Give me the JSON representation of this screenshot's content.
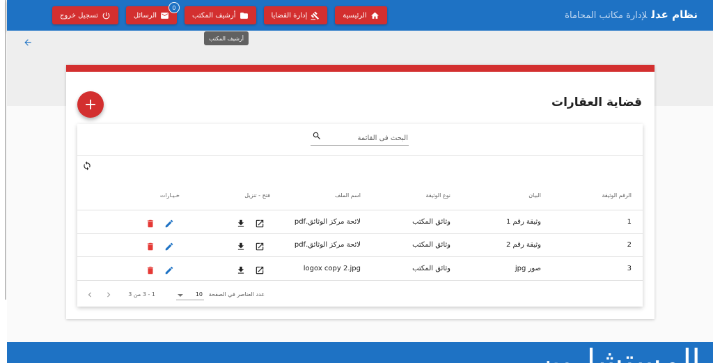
{
  "brand": {
    "name": "نظام عدل",
    "subtitle": "لإدارة مكاتب المحاماة"
  },
  "nav": [
    {
      "label": "الرئيسية",
      "icon": "home-icon"
    },
    {
      "label": "إدارة القضايا",
      "icon": "gavel-icon"
    },
    {
      "label": "أرشيف المكتب",
      "icon": "folder-icon"
    },
    {
      "label": "الرسائل",
      "icon": "mail-icon",
      "badge": "0"
    },
    {
      "label": "تسجيل خروج",
      "icon": "power-icon"
    }
  ],
  "tooltip": "أرشيف المكتب",
  "card": {
    "title": "قضاية العقارات",
    "add_label": "+"
  },
  "search": {
    "placeholder": "البحث فى القائمة"
  },
  "table": {
    "headers": [
      "الرقم الوثيقة",
      "البيان",
      "نوع الوثيقة",
      "اسم الملف",
      "فتح - تنزيل",
      "خـيـارات"
    ],
    "rows": [
      [
        "1",
        "وثيقة رقم 1",
        "وثائق المكتب",
        "لائحة مركز الوثائق.pdf"
      ],
      [
        "2",
        "وثيقة رقم 2",
        "وثائق المكتب",
        "لائحة مركز الوثائق.pdf"
      ],
      [
        "3",
        "صور jpg",
        "وثائق المكتب",
        "logox copy 2.jpg"
      ]
    ]
  },
  "pagination": {
    "items_per_page_label": "عدد العناصر في الصفحة",
    "page_size": "10",
    "range": "1 - 3 من 3"
  },
  "bottom": {
    "heading": "المستشارين"
  },
  "colors": {
    "primary": "#1e72c4",
    "accent": "#d32f2f"
  }
}
